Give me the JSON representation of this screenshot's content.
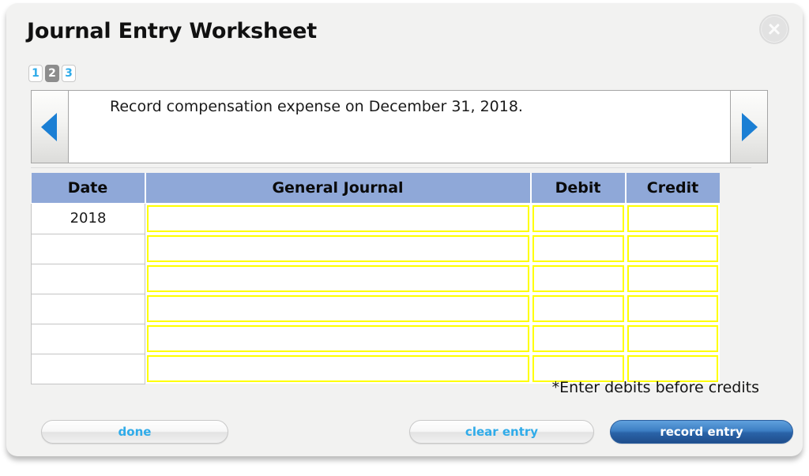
{
  "dialog": {
    "title": "Journal Entry Worksheet",
    "close_label": "X"
  },
  "tabs": {
    "items": [
      {
        "label": "1",
        "active": false
      },
      {
        "label": "2",
        "active": true
      },
      {
        "label": "3",
        "active": false
      }
    ]
  },
  "prompt": {
    "text": "Record compensation expense on December 31, 2018.",
    "prev_label": "previous",
    "next_label": "next"
  },
  "table": {
    "headers": [
      "Date",
      "General Journal",
      "Debit",
      "Credit"
    ],
    "rows": [
      {
        "date": "2018",
        "general_journal": "",
        "debit": "",
        "credit": ""
      },
      {
        "date": "",
        "general_journal": "",
        "debit": "",
        "credit": ""
      },
      {
        "date": "",
        "general_journal": "",
        "debit": "",
        "credit": ""
      },
      {
        "date": "",
        "general_journal": "",
        "debit": "",
        "credit": ""
      },
      {
        "date": "",
        "general_journal": "",
        "debit": "",
        "credit": ""
      },
      {
        "date": "",
        "general_journal": "",
        "debit": "",
        "credit": ""
      }
    ],
    "footnote": "*Enter debits before credits"
  },
  "footer": {
    "done_label": "done",
    "clear_label": "clear entry",
    "record_label": "record entry"
  },
  "colors": {
    "header_blue": "#8fa8d8",
    "field_border_yellow": "#ffff00",
    "link_blue": "#2fabe9",
    "arrow_blue": "#1b7fd4",
    "primary_button_blue": "#3d7fc4",
    "panel_background": "#f2f2f1"
  }
}
